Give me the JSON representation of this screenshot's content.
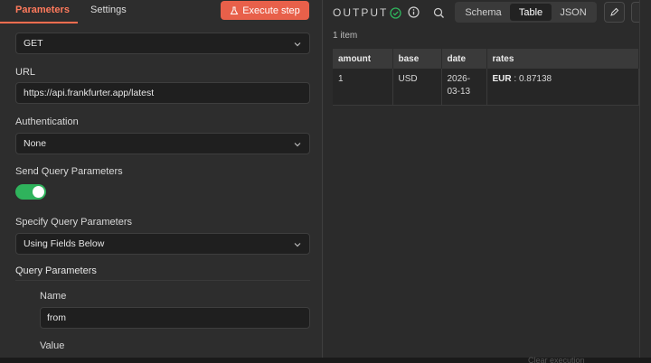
{
  "tabs": {
    "parameters": "Parameters",
    "settings": "Settings"
  },
  "execute_button": "Execute step",
  "method": {
    "value": "GET"
  },
  "url": {
    "label": "URL",
    "value": "https://api.frankfurter.app/latest"
  },
  "authentication": {
    "label": "Authentication",
    "value": "None"
  },
  "send_query": {
    "label": "Send Query Parameters",
    "enabled": true
  },
  "specify_query": {
    "label": "Specify Query Parameters",
    "value": "Using Fields Below"
  },
  "query_parameters": {
    "title": "Query Parameters",
    "name_label": "Name",
    "name_value": "from",
    "value_label": "Value"
  },
  "output": {
    "title": "OUTPUT",
    "views": [
      "Schema",
      "Table",
      "JSON"
    ],
    "active_view": "Table",
    "item_count": "1 item",
    "columns": [
      "amount",
      "base",
      "date",
      "rates"
    ],
    "row": {
      "amount": "1",
      "base": "USD",
      "date_line1": "2026-",
      "date_line2": "03-13",
      "rates_key": "EUR",
      "rates_sep": " : ",
      "rates_value": "0.87138"
    }
  },
  "footer_ghost": "Clear execution",
  "colors": {
    "accent": "#ff6d4f",
    "toggle_on": "#2fb35c",
    "success": "#2fb35c"
  }
}
